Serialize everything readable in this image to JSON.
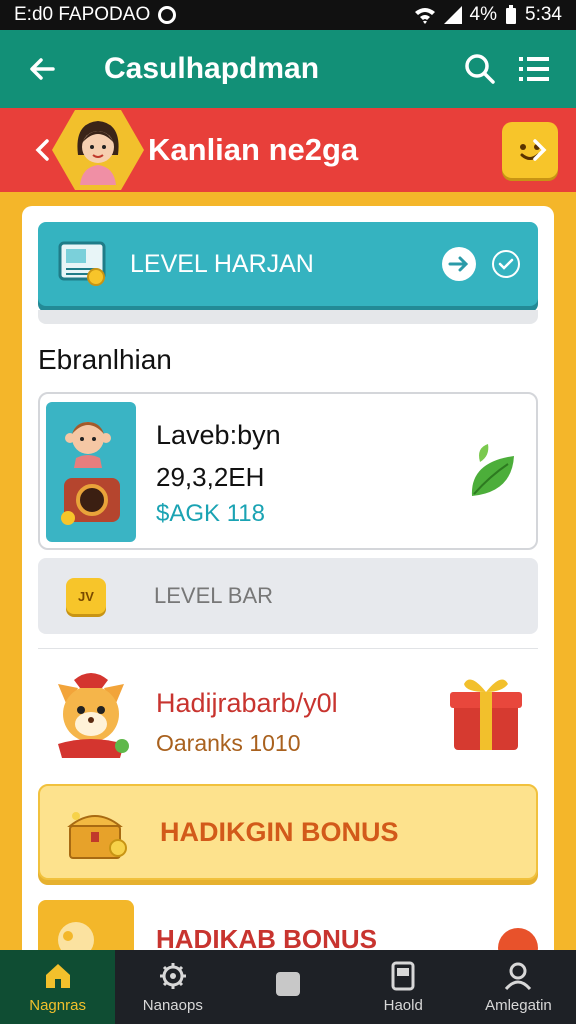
{
  "status_bar": {
    "left_text": "E:d0 FAPODAO",
    "battery": "4%",
    "time": "5:34"
  },
  "app_bar": {
    "title": "Casulhapdman"
  },
  "banner": {
    "title": "Kanlian ne2ga"
  },
  "level_header": {
    "title": "LEVEL HARJAN"
  },
  "section": {
    "title": "Ebranlhian"
  },
  "profile": {
    "name": "Laveb:byn",
    "score": "29,3,2EH",
    "money": "$AGK 118"
  },
  "level_bar": {
    "badge": "JV",
    "label": "LEVEL BAR"
  },
  "reward": {
    "title": "Hadijrabarb/y0l",
    "subtitle": "Oaranks 1010"
  },
  "bonus": {
    "primary_label": "HADIKGIN BONUS",
    "secondary_label": "HADIKAB BONUS"
  },
  "bottom_nav": {
    "items": [
      {
        "label": "Nagnras",
        "icon": "home-icon"
      },
      {
        "label": "Nanaops",
        "icon": "gear-icon"
      },
      {
        "label": "",
        "icon": "square-icon"
      },
      {
        "label": "Haold",
        "icon": "phone-icon"
      },
      {
        "label": "Amlegatin",
        "icon": "user-icon"
      }
    ]
  },
  "colors": {
    "app_bar": "#129077",
    "banner": "#e83f3a",
    "background": "#f4b62a",
    "teal": "#35b3c0",
    "nav_active": "#0f4d33"
  }
}
